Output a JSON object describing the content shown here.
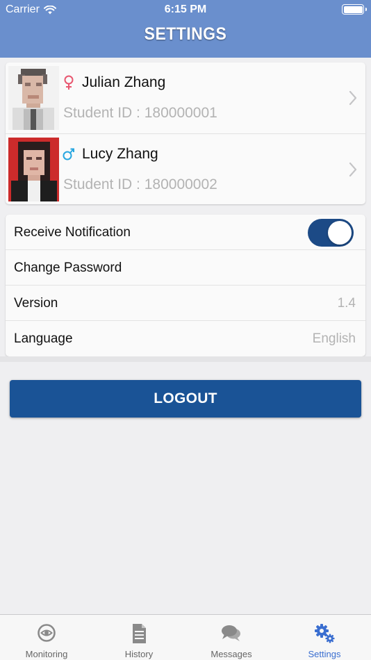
{
  "status_bar": {
    "carrier": "Carrier",
    "time": "6:15 PM"
  },
  "header": {
    "title": "SETTINGS"
  },
  "students": [
    {
      "name": "Julian Zhang",
      "id_text": "Student ID : 180000001",
      "gender_icon": "female-symbol-icon",
      "gender_color": "#e8566f"
    },
    {
      "name": "Lucy Zhang",
      "id_text": "Student ID : 180000002",
      "gender_icon": "male-symbol-icon",
      "gender_color": "#27a6e0"
    }
  ],
  "settings": {
    "notification": {
      "label": "Receive Notification",
      "enabled": true
    },
    "password": {
      "label": "Change Password"
    },
    "version": {
      "label": "Version",
      "value": "1.4"
    },
    "language": {
      "label": "Language",
      "value": "English"
    }
  },
  "logout_label": "LOGOUT",
  "tabs": [
    {
      "label": "Monitoring",
      "icon": "monitoring-icon",
      "active": false
    },
    {
      "label": "History",
      "icon": "document-icon",
      "active": false
    },
    {
      "label": "Messages",
      "icon": "chat-bubbles-icon",
      "active": false
    },
    {
      "label": "Settings",
      "icon": "gears-icon",
      "active": true
    }
  ],
  "colors": {
    "header": "#6a8fcd",
    "toggle_on": "#1c4a86",
    "logout": "#1a5396",
    "tab_active": "#3a6ed0",
    "tab_inactive": "#8a8a8a"
  }
}
